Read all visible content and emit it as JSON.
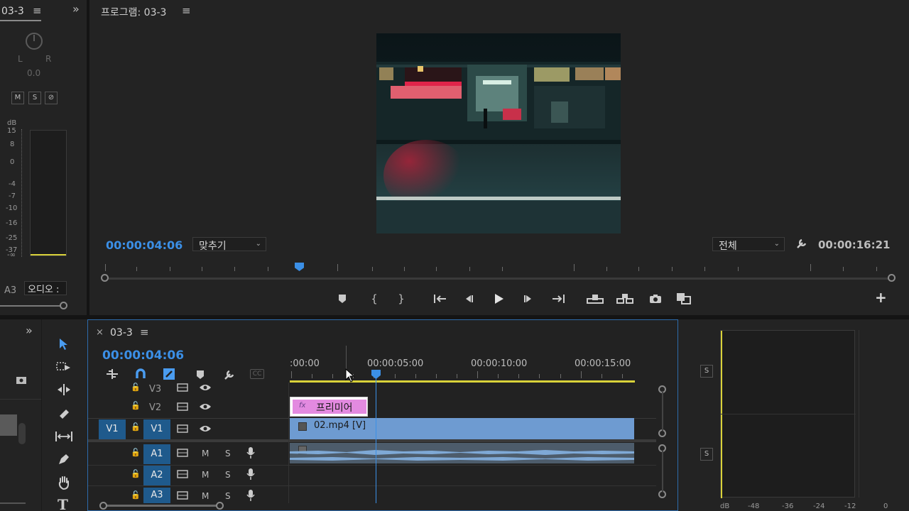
{
  "audio_mixer": {
    "title": "03-3",
    "menu": "≡",
    "expand": "»",
    "pan_l": "L",
    "pan_r": "R",
    "pan_value": "0.0",
    "btn_m": "M",
    "btn_s": "S",
    "btn_r": "⊘",
    "db_label": "dB",
    "scale": [
      "15",
      "8",
      "0",
      "-4",
      "-7",
      "-10",
      "-16",
      "-25",
      "-37",
      "-∞"
    ],
    "track": "A3",
    "channel_name": "오디오 :"
  },
  "program": {
    "title": "프로그램: 03-3",
    "menu": "≡",
    "timecode": "00:00:04:06",
    "fit_dropdown": "맞추기",
    "quality_dropdown": "전체",
    "duration": "00:00:16:21",
    "add_button": "+"
  },
  "timeline": {
    "close": "×",
    "title": "03-3",
    "menu": "≡",
    "timecode": "00:00:04:06",
    "ruler": [
      ":00:00",
      "00:00:05:00",
      "00:00:10:00",
      "00:00:15:00"
    ],
    "tracks": {
      "v3": "V3",
      "v2": "V2",
      "v1": "V1",
      "v1_source": "V1",
      "a1": "A1",
      "a2": "A2",
      "a3": "A3",
      "m": "M",
      "s": "S"
    },
    "clips": {
      "title_clip": "프리미어",
      "video_clip": "02.mp4 [V]",
      "fx": "fx"
    }
  },
  "tools": {
    "expand": "»"
  },
  "meters": {
    "s1": "S",
    "s2": "S",
    "scale": [
      "dB",
      "-48",
      "-36",
      "-24",
      "-12",
      "0"
    ]
  },
  "colors": {
    "timecode": "#3b8fe6",
    "playhead": "#3b8fe6",
    "video_clip": "#6e9bd1",
    "title_clip": "#e38ae0",
    "work_area": "#d9d23a"
  }
}
